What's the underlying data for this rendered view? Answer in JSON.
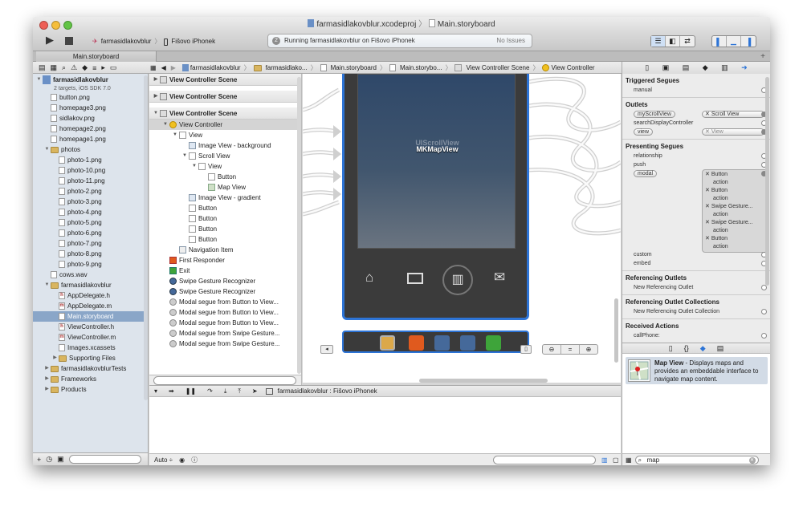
{
  "window": {
    "title_project": "farmasidlakovblur.xcodeproj",
    "title_file": "Main.storyboard",
    "scheme": "farmasidlakovblur",
    "device": "Fišovo iPhonek",
    "activity": "Running farmasidlakovblur on Fišovo iPhonek",
    "issues": "No Issues",
    "tab": "Main.storyboard"
  },
  "jumpbar": {
    "crumbs": [
      "farmasidlakovblur",
      "farmasidlako...",
      "Main.storyboard",
      "Main.storybo...",
      "View Controller Scene",
      "View Controller"
    ]
  },
  "navigator": {
    "items": [
      {
        "label": "farmasidlakovblur",
        "type": "project",
        "indent": 0,
        "disc": "▼",
        "bold": true
      },
      {
        "label": "2 targets, iOS SDK 7.0",
        "type": "sub",
        "indent": 0,
        "disc": ""
      },
      {
        "label": "button.png",
        "type": "file",
        "indent": 1,
        "disc": ""
      },
      {
        "label": "homepage3.png",
        "type": "file",
        "indent": 1,
        "disc": ""
      },
      {
        "label": "sidlakov.png",
        "type": "file",
        "indent": 1,
        "disc": ""
      },
      {
        "label": "homepage2.png",
        "type": "file",
        "indent": 1,
        "disc": ""
      },
      {
        "label": "homepage1.png",
        "type": "file",
        "indent": 1,
        "disc": ""
      },
      {
        "label": "photos",
        "type": "folder",
        "indent": 1,
        "disc": "▼"
      },
      {
        "label": "photo-1.png",
        "type": "file",
        "indent": 2,
        "disc": ""
      },
      {
        "label": "photo-10.png",
        "type": "file",
        "indent": 2,
        "disc": ""
      },
      {
        "label": "photo-11.png",
        "type": "file",
        "indent": 2,
        "disc": ""
      },
      {
        "label": "photo-2.png",
        "type": "file",
        "indent": 2,
        "disc": ""
      },
      {
        "label": "photo-3.png",
        "type": "file",
        "indent": 2,
        "disc": ""
      },
      {
        "label": "photo-4.png",
        "type": "file",
        "indent": 2,
        "disc": ""
      },
      {
        "label": "photo-5.png",
        "type": "file",
        "indent": 2,
        "disc": ""
      },
      {
        "label": "photo-6.png",
        "type": "file",
        "indent": 2,
        "disc": ""
      },
      {
        "label": "photo-7.png",
        "type": "file",
        "indent": 2,
        "disc": ""
      },
      {
        "label": "photo-8.png",
        "type": "file",
        "indent": 2,
        "disc": ""
      },
      {
        "label": "photo-9.png",
        "type": "file",
        "indent": 2,
        "disc": ""
      },
      {
        "label": "cows.wav",
        "type": "file",
        "indent": 1,
        "disc": ""
      },
      {
        "label": "farmasidlakovblur",
        "type": "folder",
        "indent": 1,
        "disc": "▼"
      },
      {
        "label": "AppDelegate.h",
        "type": "hfile",
        "indent": 2,
        "disc": ""
      },
      {
        "label": "AppDelegate.m",
        "type": "mfile",
        "indent": 2,
        "disc": ""
      },
      {
        "label": "Main.storyboard",
        "type": "file",
        "indent": 2,
        "disc": "",
        "selected": true
      },
      {
        "label": "ViewController.h",
        "type": "hfile",
        "indent": 2,
        "disc": ""
      },
      {
        "label": "ViewController.m",
        "type": "mfile",
        "indent": 2,
        "disc": ""
      },
      {
        "label": "Images.xcassets",
        "type": "file",
        "indent": 2,
        "disc": ""
      },
      {
        "label": "Supporting Files",
        "type": "folder",
        "indent": 2,
        "disc": "▶"
      },
      {
        "label": "farmasidlakovblurTests",
        "type": "folder",
        "indent": 1,
        "disc": "▶"
      },
      {
        "label": "Frameworks",
        "type": "folder",
        "indent": 1,
        "disc": "▶"
      },
      {
        "label": "Products",
        "type": "folder",
        "indent": 1,
        "disc": "▶"
      }
    ]
  },
  "outline": {
    "rows": [
      {
        "label": "View Controller Scene",
        "kind": "scene",
        "indent": 0,
        "disc": "▶"
      },
      {
        "label": "View Controller Scene",
        "kind": "scene",
        "indent": 0,
        "disc": "▶"
      },
      {
        "label": "View Controller Scene",
        "kind": "scene",
        "indent": 0,
        "disc": "▼"
      },
      {
        "label": "View Controller",
        "kind": "row",
        "indent": 1,
        "disc": "▼",
        "hl": true,
        "icon": "yellow"
      },
      {
        "label": "View",
        "kind": "row",
        "indent": 2,
        "disc": "▼",
        "icon": "box"
      },
      {
        "label": "Image View - background",
        "kind": "row",
        "indent": 3,
        "disc": "",
        "icon": "img"
      },
      {
        "label": "Scroll View",
        "kind": "row",
        "indent": 3,
        "disc": "▼",
        "icon": "box"
      },
      {
        "label": "View",
        "kind": "row",
        "indent": 4,
        "disc": "▼",
        "icon": "box"
      },
      {
        "label": "Button",
        "kind": "row",
        "indent": 5,
        "disc": "",
        "icon": "box"
      },
      {
        "label": "Map View",
        "kind": "row",
        "indent": 5,
        "disc": "",
        "icon": "map"
      },
      {
        "label": "Image View - gradient",
        "kind": "row",
        "indent": 3,
        "disc": "",
        "icon": "img"
      },
      {
        "label": "Button",
        "kind": "row",
        "indent": 3,
        "disc": "",
        "icon": "box"
      },
      {
        "label": "Button",
        "kind": "row",
        "indent": 3,
        "disc": "",
        "icon": "box"
      },
      {
        "label": "Button",
        "kind": "row",
        "indent": 3,
        "disc": "",
        "icon": "box"
      },
      {
        "label": "Button",
        "kind": "row",
        "indent": 3,
        "disc": "",
        "icon": "box"
      },
      {
        "label": "Navigation Item",
        "kind": "row",
        "indent": 2,
        "disc": "",
        "icon": "nav"
      },
      {
        "label": "First Responder",
        "kind": "row",
        "indent": 1,
        "disc": "",
        "icon": "cube"
      },
      {
        "label": "Exit",
        "kind": "row",
        "indent": 1,
        "disc": "",
        "icon": "exit"
      },
      {
        "label": "Swipe Gesture Recognizer",
        "kind": "row",
        "indent": 1,
        "disc": "",
        "icon": "gesture"
      },
      {
        "label": "Swipe Gesture Recognizer",
        "kind": "row",
        "indent": 1,
        "disc": "",
        "icon": "gesture"
      },
      {
        "label": "Modal segue from Button to View...",
        "kind": "row",
        "indent": 1,
        "disc": "",
        "icon": "segue"
      },
      {
        "label": "Modal segue from Button to View...",
        "kind": "row",
        "indent": 1,
        "disc": "",
        "icon": "segue"
      },
      {
        "label": "Modal segue from Button to View...",
        "kind": "row",
        "indent": 1,
        "disc": "",
        "icon": "segue"
      },
      {
        "label": "Modal segue from Swipe Gesture...",
        "kind": "row",
        "indent": 1,
        "disc": "",
        "icon": "segue"
      },
      {
        "label": "Modal segue from Swipe Gesture...",
        "kind": "row",
        "indent": 1,
        "disc": "",
        "icon": "segue"
      }
    ]
  },
  "canvas": {
    "map_label": "MKMapView",
    "scroll_label": "UIScrollView"
  },
  "debug": {
    "target": "farmasidlakovblur : Fišovo iPhonek",
    "auto": "Auto ÷"
  },
  "inspector": {
    "triggered_title": "Triggered Segues",
    "triggered": [
      "manual"
    ],
    "outlets_title": "Outlets",
    "outlets": [
      {
        "name": "myScrollView",
        "pill": true,
        "target": "Scroll View",
        "connected": true
      },
      {
        "name": "searchDisplayController",
        "pill": false,
        "target": "",
        "connected": false
      },
      {
        "name": "view",
        "pill": true,
        "target": "View",
        "connected": true
      }
    ],
    "presenting_title": "Presenting Segues",
    "presenting": [
      "relationship",
      "push"
    ],
    "modal_name": "modal",
    "modal_items": [
      "Button",
      "action",
      "Button",
      "action",
      "Swipe Gesture...",
      "action",
      "Swipe Gesture...",
      "action",
      "Button",
      "action"
    ],
    "presenting_after": [
      "custom",
      "embed"
    ],
    "ref_outlets_title": "Referencing Outlets",
    "ref_outlets_item": "New Referencing Outlet",
    "ref_coll_title": "Referencing Outlet Collections",
    "ref_coll_item": "New Referencing Outlet Collection",
    "received_title": "Received Actions",
    "received_item": "callPhone:"
  },
  "library": {
    "item_title": "Map View",
    "item_desc": " - Displays maps and provides an embeddable interface to navigate map content.",
    "search_value": "map"
  },
  "colors": {
    "selection_blue": "#2d74d6",
    "nav_bg": "#dde4ec",
    "nav_selected": "#8aa6c8"
  }
}
